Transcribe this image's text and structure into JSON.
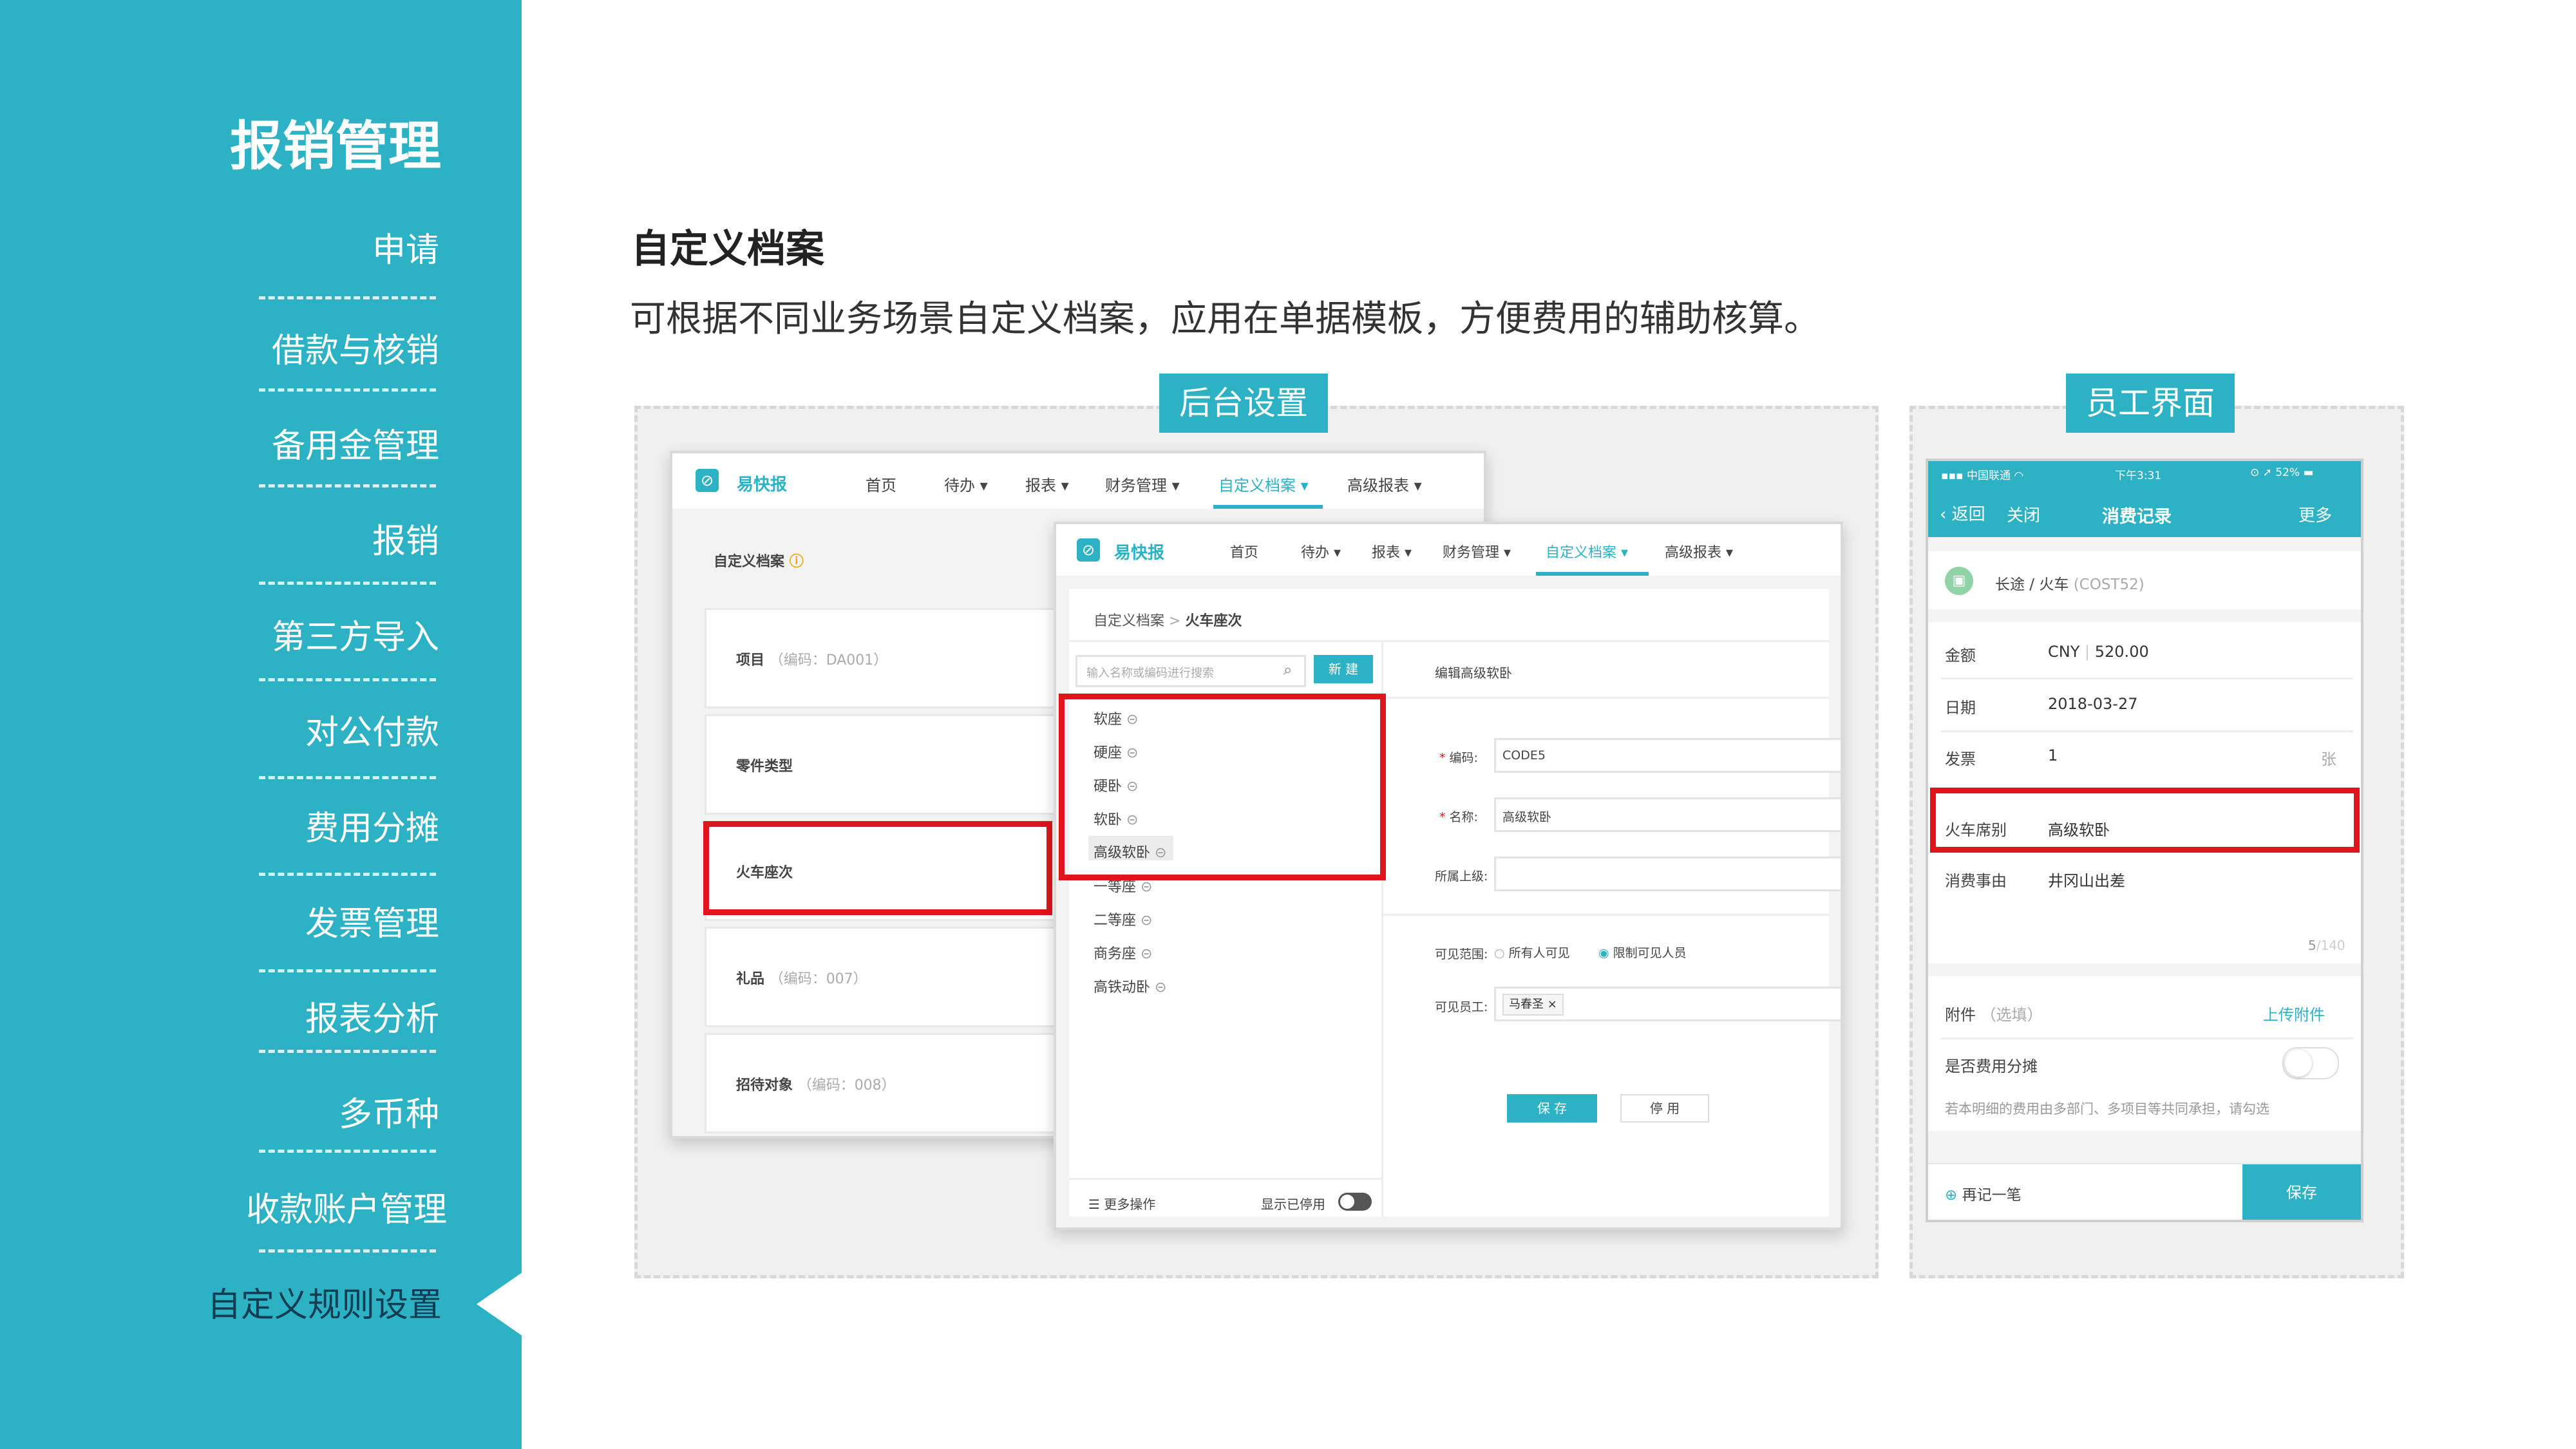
{
  "sidebar": {
    "title": "报销管理",
    "items": [
      "申请",
      "借款与核销",
      "备用金管理",
      "报销",
      "第三方导入",
      "对公付款",
      "费用分摊",
      "发票管理",
      "报表分析",
      "多币种",
      "收款账户管理",
      "自定义规则设置"
    ]
  },
  "content": {
    "title": "自定义档案",
    "subtitle": "可根据不同业务场景自定义档案，应用在单据模板，方便费用的辅助核算。"
  },
  "panels": {
    "backend_tag": "后台设置",
    "employee_tag": "员工界面"
  },
  "app": {
    "brand": "易快报",
    "nav": [
      "首页",
      "待办",
      "报表",
      "财务管理",
      "自定义档案",
      "高级报表"
    ]
  },
  "back_window": {
    "heading": "自定义档案",
    "cards": [
      {
        "name": "项目",
        "code": "（编码：DA001）"
      },
      {
        "name": "零件类型",
        "code": ""
      },
      {
        "name": "火车座次",
        "code": ""
      },
      {
        "name": "礼品",
        "code": "（编码：007）"
      },
      {
        "name": "招待对象",
        "code": "（编码：008）"
      }
    ]
  },
  "front_window": {
    "breadcrumb_root": "自定义档案",
    "breadcrumb_sep": ">",
    "breadcrumb_current": "火车座次",
    "search_placeholder": "输入名称或编码进行搜索",
    "new_button": "新 建",
    "list": [
      "软座",
      "硬座",
      "硬卧",
      "软卧",
      "高级软卧",
      "一等座",
      "二等座",
      "商务座",
      "高铁动卧"
    ],
    "more_ops": "更多操作",
    "show_disabled": "显示已停用",
    "edit_title": "编辑高级软卧",
    "form": {
      "code_label": "编码:",
      "code_value": "CODE5",
      "name_label": "名称:",
      "name_value": "高级软卧",
      "parent_label": "所属上级:",
      "visible_label": "可见范围:",
      "visible_opt_all": "所有人可见",
      "visible_opt_limited": "限制可见人员",
      "staff_label": "可见员工:",
      "staff_tag": "马春圣 ×",
      "save": "保 存",
      "disable": "停 用"
    }
  },
  "phone": {
    "carrier": "中国联通",
    "time": "下午3:31",
    "battery": "52%",
    "back": "返回",
    "close": "关闭",
    "title": "消费记录",
    "more": "更多",
    "category": "长途 / 火车",
    "category_code": "(COST52)",
    "amount_label": "金额",
    "currency": "CNY",
    "amount": "520.00",
    "date_label": "日期",
    "date": "2018-03-27",
    "invoice_label": "发票",
    "invoice_count": "1",
    "invoice_unit": "张",
    "seat_label": "火车席别",
    "seat_value": "高级软卧",
    "reason_label": "消费事由",
    "reason_value": "井冈山出差",
    "char_count": "5",
    "char_max": "/140",
    "attach_label": "附件",
    "attach_optional": "（选填）",
    "attach_link": "上传附件",
    "split_label": "是否费用分摊",
    "split_hint": "若本明细的费用由多部门、多项目等共同承担，请勾选",
    "again": "再记一笔",
    "save": "保存"
  },
  "colors": {
    "brand": "#2cb2c4",
    "highlight": "#e0141c"
  }
}
